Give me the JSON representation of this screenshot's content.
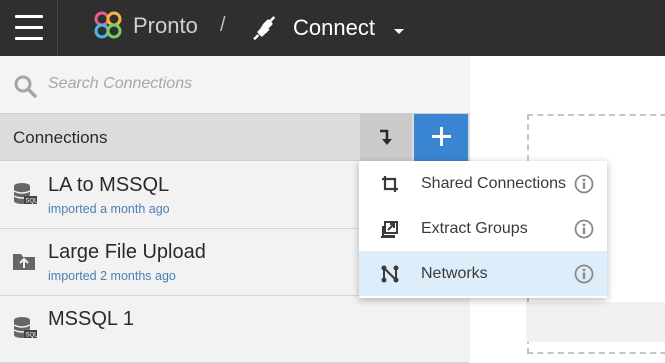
{
  "header": {
    "app_name": "Pronto",
    "separator": "/",
    "page_title": "Connect"
  },
  "search": {
    "placeholder": "Search Connections",
    "value": ""
  },
  "connections_panel": {
    "title": "Connections",
    "items": [
      {
        "name": "LA to MSSQL",
        "meta": "imported a month ago",
        "icon": "sql-database-icon"
      },
      {
        "name": "Large File Upload",
        "meta": "imported 2 months ago",
        "icon": "folder-upload-icon"
      },
      {
        "name": "MSSQL 1",
        "meta": "",
        "icon": "sql-database-icon"
      }
    ]
  },
  "dropdown": {
    "items": [
      {
        "label": "Shared Connections",
        "icon": "crop-icon",
        "active": false
      },
      {
        "label": "Extract Groups",
        "icon": "export-icon",
        "active": false
      },
      {
        "label": "Networks",
        "icon": "network-icon",
        "active": true
      }
    ]
  },
  "colors": {
    "header_bg": "#2f2f2f",
    "accent_blue": "#3a85d1",
    "link_blue": "#4a7fb3",
    "active_item_bg": "#ddeefa"
  }
}
